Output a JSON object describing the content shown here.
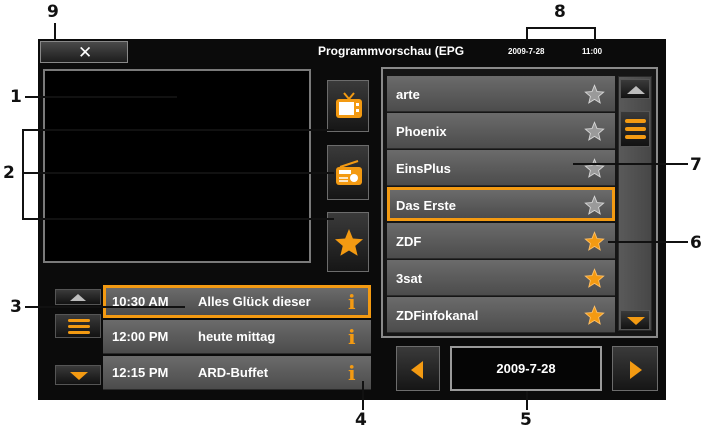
{
  "header": {
    "title": "Programmvorschau (EPG",
    "date": "2009-7-28",
    "time": "11:00"
  },
  "callouts": [
    "1",
    "2",
    "3",
    "4",
    "5",
    "6",
    "7",
    "8",
    "9"
  ],
  "channels": [
    {
      "name": "arte",
      "favorite": false
    },
    {
      "name": "Phoenix",
      "favorite": false
    },
    {
      "name": "EinsPlus",
      "favorite": false
    },
    {
      "name": "Das Erste",
      "favorite": false
    },
    {
      "name": "ZDF",
      "favorite": true
    },
    {
      "name": "3sat",
      "favorite": true
    },
    {
      "name": "ZDFinfokanal",
      "favorite": true
    }
  ],
  "programs": [
    {
      "time": "10:30 AM",
      "title": "Alles Glück dieser"
    },
    {
      "time": "12:00 PM",
      "title": "heute mittag"
    },
    {
      "time": "12:15 PM",
      "title": "ARD-Buffet"
    }
  ],
  "date_nav": {
    "date": "2009-7-28"
  },
  "icons": {
    "close": "close-icon",
    "tv": "tv-icon",
    "radio": "radio-icon",
    "fav": "star-icon",
    "info": "info-icon"
  },
  "colors": {
    "accent": "#f39a12",
    "row": "#5c5c5c",
    "background": "#0b0b0b"
  }
}
